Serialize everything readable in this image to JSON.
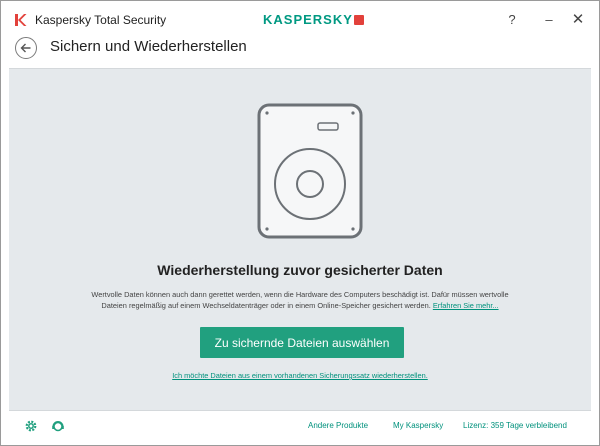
{
  "titlebar": {
    "app_title": "Kaspersky Total Security",
    "brand": "KASPERSKY",
    "help": "?",
    "minimize": "–",
    "close": "✕"
  },
  "header": {
    "title": "Sichern und Wiederherstellen"
  },
  "main": {
    "heading": "Wiederherstellung zuvor gesicherter Daten",
    "description_line1": "Wertvolle Daten können auch dann gerettet werden, wenn die Hardware des Computers beschädigt ist. Dafür müssen wertvolle",
    "description_line2": "Dateien regelmäßig auf einem Wechseldatenträger oder in einem Online-Speicher gesichert werden.",
    "learn_more": "Erfahren Sie mehr...",
    "primary_button": "Zu sichernde Dateien auswählen",
    "restore_link": "Ich möchte Dateien aus einem vorhandenen Sicherungssatz wiederherstellen."
  },
  "footer": {
    "other_products": "Andere Produkte",
    "my_kaspersky": "My Kaspersky",
    "license": "Lizenz: 359 Tage verbleibend"
  },
  "icons": {
    "app_logo": "kaspersky-k-icon",
    "back": "back-arrow-icon",
    "settings": "gear-icon",
    "support": "support-agent-icon",
    "illustration": "hard-disk-icon"
  },
  "colors": {
    "accent": "#21a07f",
    "link": "#00917c",
    "panel_bg": "#e5e9ec",
    "brand_red": "#e2413b"
  }
}
